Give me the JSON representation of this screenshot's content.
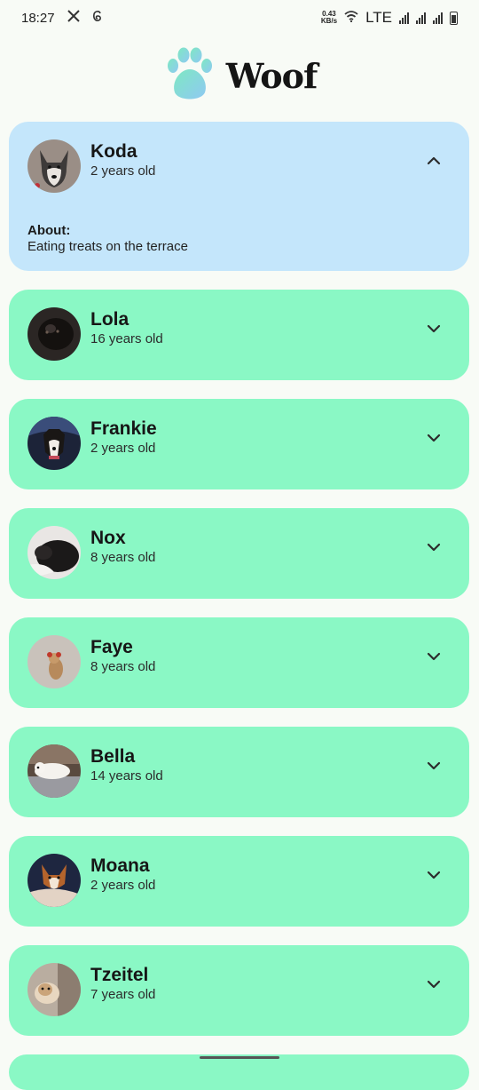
{
  "status_bar": {
    "time": "18:27",
    "speed_value": "0.43",
    "speed_unit": "KB/s",
    "network": "LTE",
    "left_icons": [
      "x-icon",
      "threads-icon"
    ],
    "right_icons": [
      "wifi-icon",
      "signal-icon",
      "battery-icon"
    ]
  },
  "app": {
    "title": "Woof",
    "logo_icon": "paw-icon"
  },
  "colors": {
    "card_collapsed": "#8af8c5",
    "card_expanded": "#c4e6fb",
    "background": "#f8fbf6"
  },
  "dogs": [
    {
      "name": "Koda",
      "age": "2 years old",
      "expanded": true,
      "about_label": "About:",
      "about": "Eating treats on the terrace"
    },
    {
      "name": "Lola",
      "age": "16 years old",
      "expanded": false
    },
    {
      "name": "Frankie",
      "age": "2 years old",
      "expanded": false
    },
    {
      "name": "Nox",
      "age": "8 years old",
      "expanded": false
    },
    {
      "name": "Faye",
      "age": "8 years old",
      "expanded": false
    },
    {
      "name": "Bella",
      "age": "14 years old",
      "expanded": false
    },
    {
      "name": "Moana",
      "age": "2 years old",
      "expanded": false
    },
    {
      "name": "Tzeitel",
      "age": "7 years old",
      "expanded": false
    }
  ]
}
